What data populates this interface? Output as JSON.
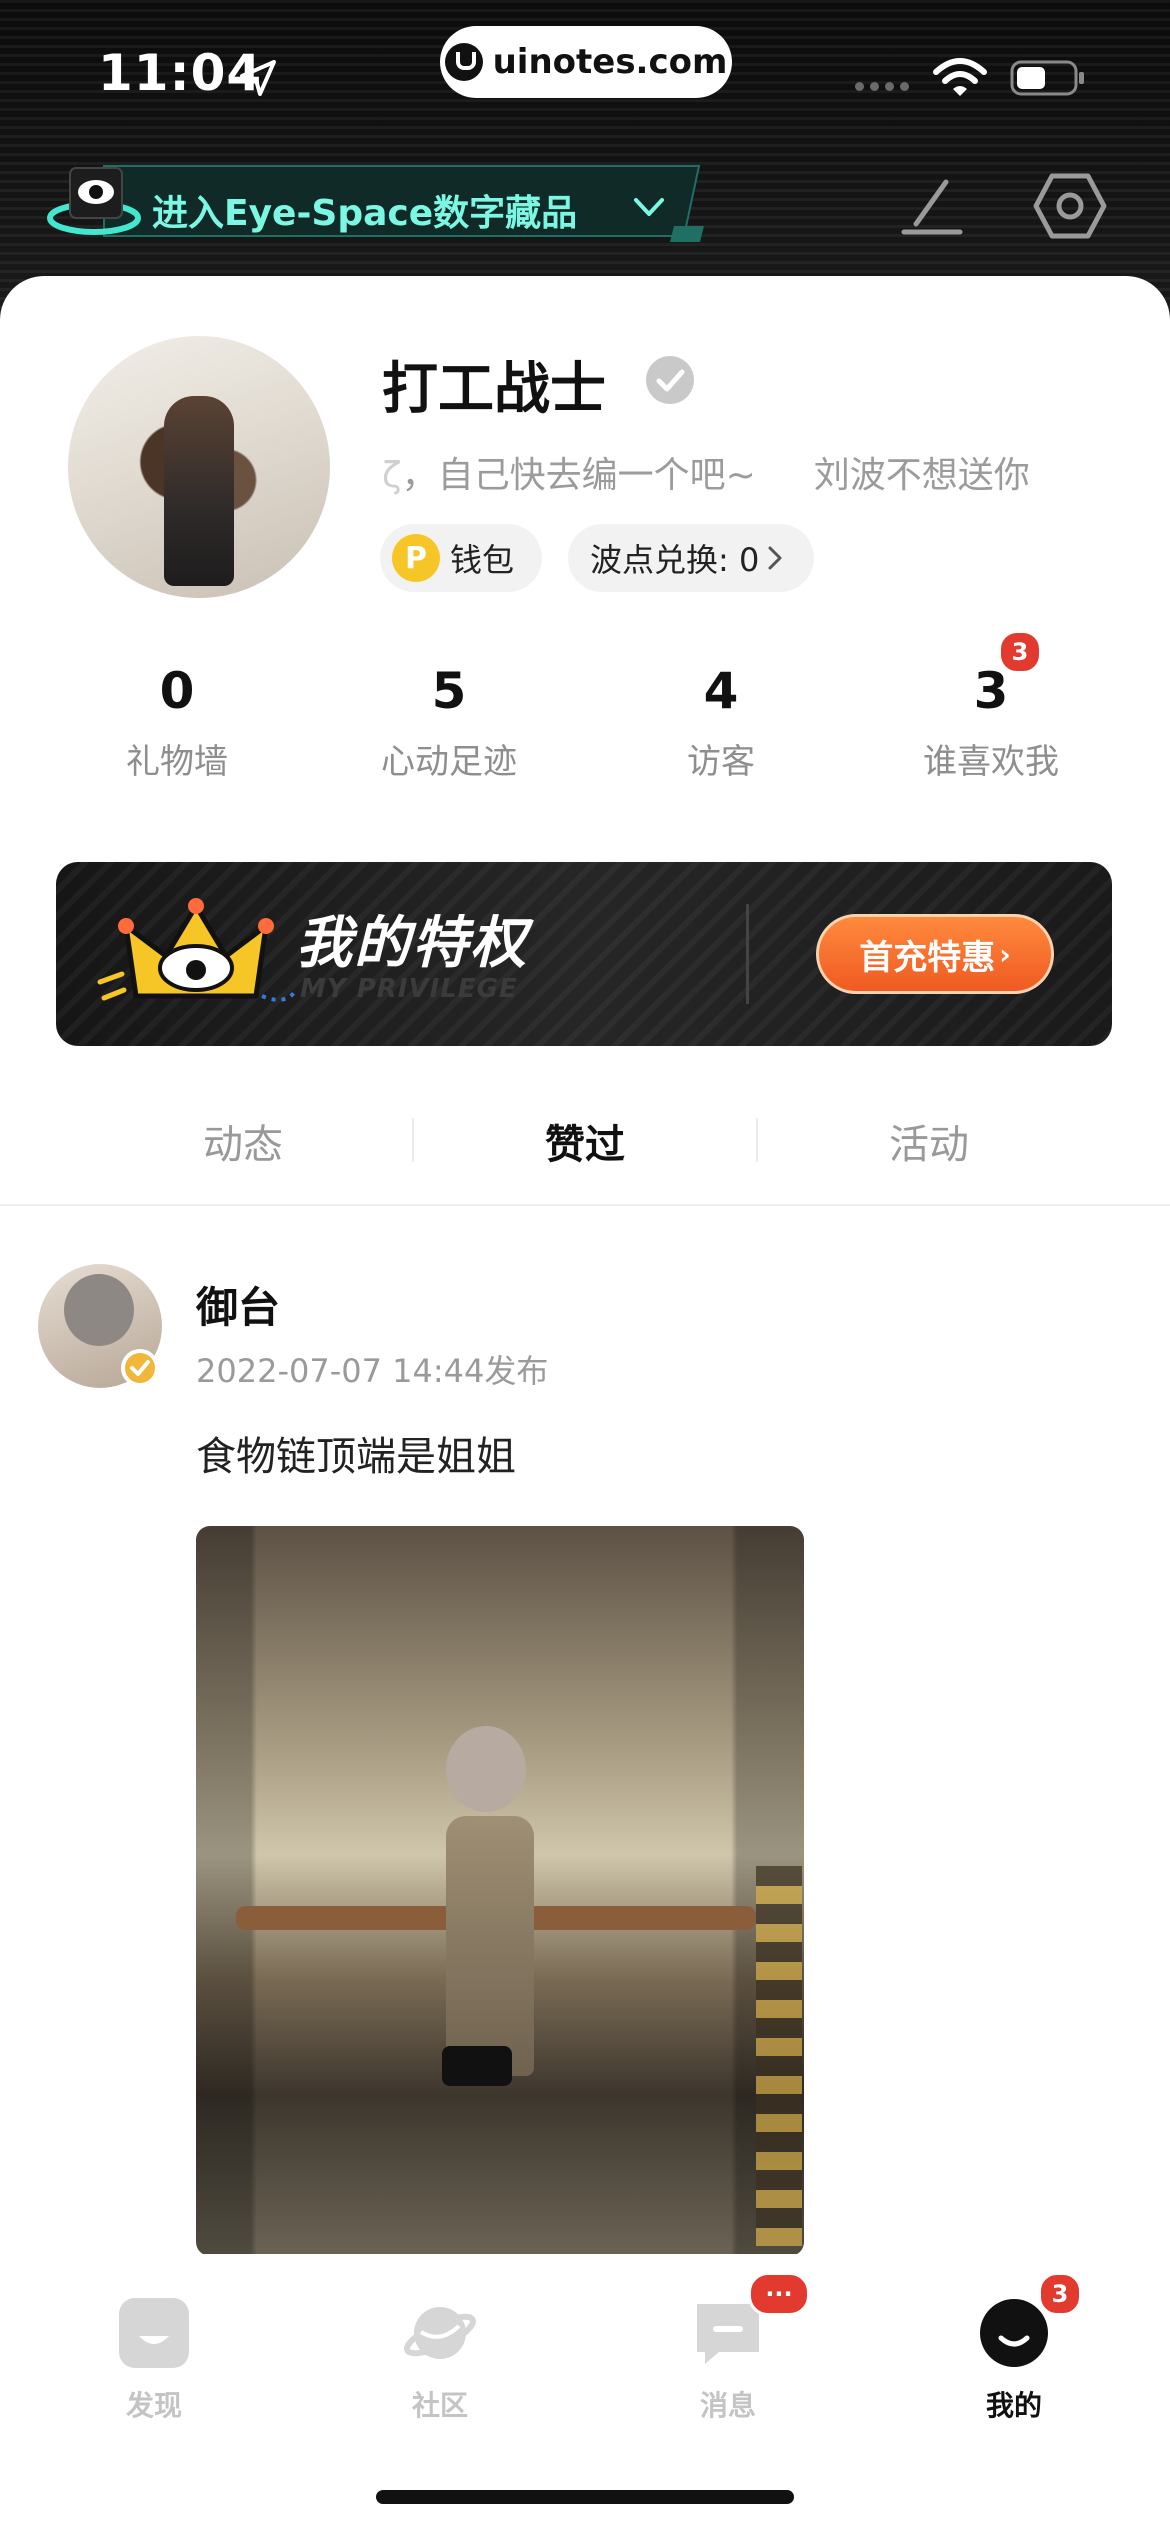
{
  "status_bar": {
    "time": "11:04",
    "url": "uinotes.com"
  },
  "header": {
    "eye_space_label": "进入Eye-Space数字藏品"
  },
  "profile": {
    "username": "打工战士",
    "bio_left": "，自己快去编一个吧~",
    "bio_right": "刘波不想送你",
    "bio_prefix": "ζ",
    "wallet_label": "钱包",
    "wallet_coin": "P",
    "exchange_label": "波点兑换: 0"
  },
  "stats": [
    {
      "value": "0",
      "label": "礼物墙"
    },
    {
      "value": "5",
      "label": "心动足迹"
    },
    {
      "value": "4",
      "label": "访客"
    },
    {
      "value": "3",
      "label": "谁喜欢我",
      "badge": "3"
    }
  ],
  "privilege": {
    "title": "我的特权",
    "subtitle": "MY PRIVILEGE",
    "button": "首充特惠",
    "button_arrow": "›"
  },
  "tabs": [
    {
      "label": "动态",
      "active": false
    },
    {
      "label": "赞过",
      "active": true
    },
    {
      "label": "活动",
      "active": false
    }
  ],
  "post": {
    "author": "御台",
    "date": "2022-07-07 14:44发布",
    "text": "食物链顶端是姐姐"
  },
  "bottom_nav": [
    {
      "label": "发现",
      "icon": "discover-icon",
      "active": false
    },
    {
      "label": "社区",
      "icon": "planet-icon",
      "active": false
    },
    {
      "label": "消息",
      "icon": "message-icon",
      "active": false,
      "badge": "···"
    },
    {
      "label": "我的",
      "icon": "profile-icon",
      "active": true,
      "badge": "3"
    }
  ],
  "colors": {
    "accent_teal": "#7cf7e4",
    "badge_red": "#e23a2f",
    "privilege_orange": "#ef5a22",
    "coin_yellow": "#f6c526"
  }
}
